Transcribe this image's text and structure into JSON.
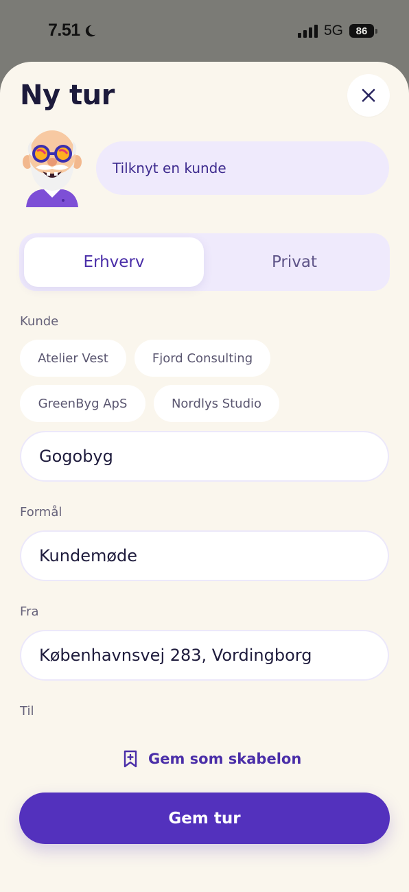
{
  "status_bar": {
    "time": "7.51",
    "network": "5G",
    "battery": "86"
  },
  "header": {
    "title": "Ny tur",
    "close_icon": "close-icon"
  },
  "assistant": {
    "prompt": "Tilknyt en kunde"
  },
  "trip_type": {
    "options": [
      "Erhverv",
      "Privat"
    ],
    "selected": "Erhverv"
  },
  "customer": {
    "label": "Kunde",
    "suggestions": [
      "Atelier Vest",
      "Fjord Consulting",
      "GreenByg ApS",
      "Nordlys Studio"
    ],
    "value": "Gogobyg"
  },
  "purpose": {
    "label": "Formål",
    "value": "Kundemøde"
  },
  "from": {
    "label": "Fra",
    "value": "Københavnsvej 283, Vordingborg"
  },
  "to": {
    "label": "Til"
  },
  "actions": {
    "save_template": "Gem som skabelon",
    "save_template_icon": "bookmark-plus-icon",
    "save_trip": "Gem tur"
  },
  "colors": {
    "accent": "#5331bd",
    "sheet_background": "#faf6ed",
    "soft_purple": "#efeafc",
    "title": "#1c1a3b"
  }
}
